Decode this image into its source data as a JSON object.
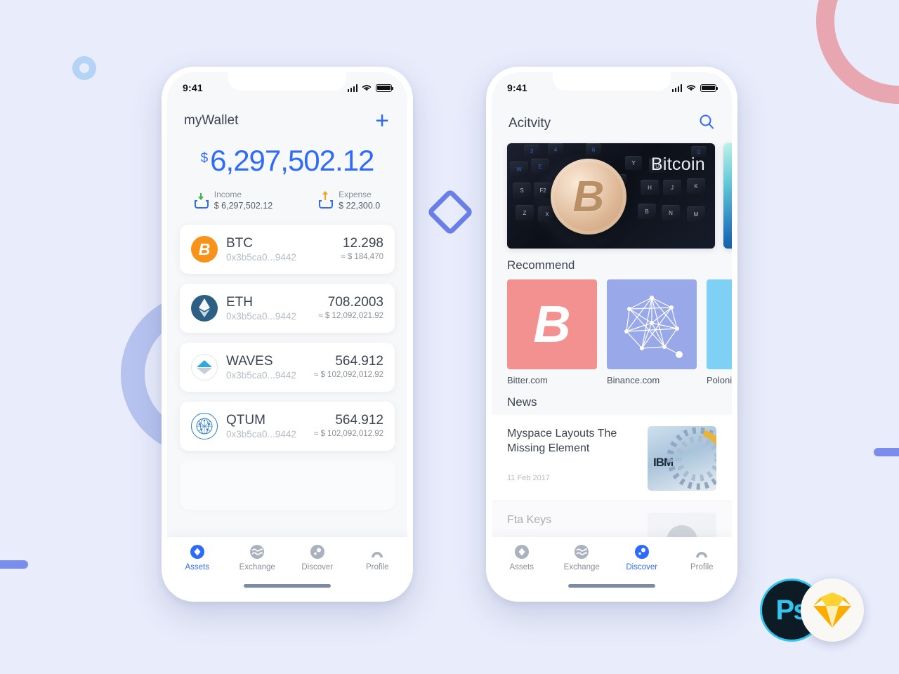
{
  "background": {
    "color": "#e8ecfb",
    "shapes": [
      {
        "name": "ring-small",
        "color": "#b3d4f5"
      },
      {
        "name": "arc-pink",
        "color": "#e8a7b0"
      },
      {
        "name": "arc-purple",
        "color": "#b7c3ef"
      },
      {
        "name": "bar-left",
        "color": "#7a8cec"
      },
      {
        "name": "bar-right",
        "color": "#7a8cec"
      },
      {
        "name": "diamond",
        "color": "#6b7fe8"
      }
    ]
  },
  "logos": {
    "photoshop_label": "Ps",
    "photoshop_color": "#31c5f0",
    "sketch_color": "#f7b500"
  },
  "accent_color": "#2f6bfa",
  "wallet_screen": {
    "status_bar": {
      "time": "9:41",
      "signal_icon": "cellular-signal-icon",
      "wifi_icon": "wifi-icon",
      "battery_icon": "battery-icon"
    },
    "header": {
      "title": "myWallet",
      "add_label": "+"
    },
    "balance": {
      "currency_symbol": "$",
      "amount": "6,297,502.12"
    },
    "summary": [
      {
        "icon": "income-tray-icon",
        "label": "Income",
        "value": "$ 6,297,502.12",
        "arrow_color": "#3ab54a"
      },
      {
        "icon": "expense-tray-icon",
        "label": "Expense",
        "value": "$ 22,300.0",
        "arrow_color": "#f6a21e"
      }
    ],
    "assets": [
      {
        "icon": "btc-coin-icon",
        "symbol": "BTC",
        "address": "0x3b5ca0...9442",
        "amount": "12.298",
        "fiat": "≈ $ 184,470"
      },
      {
        "icon": "eth-coin-icon",
        "symbol": "ETH",
        "address": "0x3b5ca0...9442",
        "amount": "708.2003",
        "fiat": "≈ $ 12,092,021.92"
      },
      {
        "icon": "waves-coin-icon",
        "symbol": "WAVES",
        "address": "0x3b5ca0...9442",
        "amount": "564.912",
        "fiat": "≈ $ 102,092,012.92"
      },
      {
        "icon": "qtum-coin-icon",
        "symbol": "QTUM",
        "address": "0x3b5ca0...9442",
        "amount": "564.912",
        "fiat": "≈ $ 102,092,012.92"
      }
    ],
    "tabs": [
      {
        "icon": "assets-diamond-icon",
        "label": "Assets",
        "active": true
      },
      {
        "icon": "exchange-waves-icon",
        "label": "Exchange",
        "active": false
      },
      {
        "icon": "discover-compass-icon",
        "label": "Discover",
        "active": false
      },
      {
        "icon": "profile-person-icon",
        "label": "Profile",
        "active": false
      }
    ]
  },
  "discover_screen": {
    "status_bar": {
      "time": "9:41",
      "signal_icon": "cellular-signal-icon",
      "wifi_icon": "wifi-icon",
      "battery_icon": "battery-icon"
    },
    "header": {
      "title": "Acitvity",
      "search_icon": "search-icon"
    },
    "hero_cards": [
      {
        "caption": "Bitcoin",
        "image": "bitcoin-coin-on-keyboard"
      },
      {
        "caption": "",
        "image": "teal-abstract"
      }
    ],
    "recommend": {
      "title": "Recommend",
      "items": [
        {
          "label": "Bitter.com",
          "color": "#f2918f",
          "icon": "bitcoin-b-icon"
        },
        {
          "label": "Binance.com",
          "color": "#98a8e8",
          "icon": "network-mesh-icon"
        },
        {
          "label": "Polonie",
          "color": "#7fd0f5",
          "icon": "placeholder-icon"
        }
      ]
    },
    "news": {
      "title": "News",
      "items": [
        {
          "title": "Myspace Layouts The Missing Element",
          "date": "11 Feb 2017",
          "thumb": "ibm-rings-thumbnail"
        },
        {
          "title": "Fta Keys",
          "date": "",
          "thumb": "person-avatar-thumbnail"
        }
      ]
    },
    "tabs": [
      {
        "icon": "assets-diamond-icon",
        "label": "Assets",
        "active": false
      },
      {
        "icon": "exchange-waves-icon",
        "label": "Exchange",
        "active": false
      },
      {
        "icon": "discover-compass-icon",
        "label": "Discover",
        "active": true
      },
      {
        "icon": "profile-person-icon",
        "label": "Profile",
        "active": false
      }
    ]
  }
}
